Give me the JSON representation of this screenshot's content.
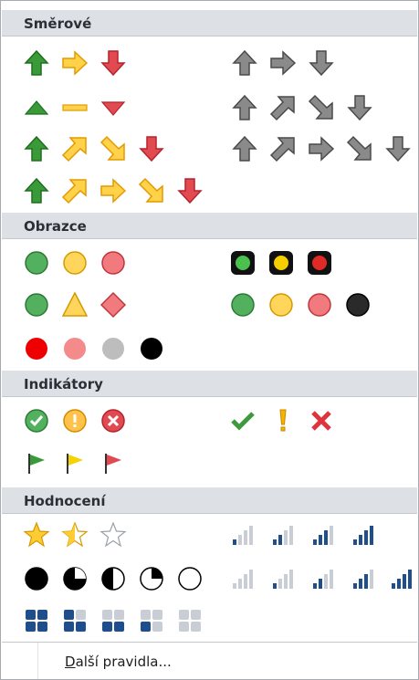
{
  "sections": {
    "directional": "Směrové",
    "shapes": "Obrazce",
    "indicators": "Indikátory",
    "ratings": "Hodnocení"
  },
  "more_rules": {
    "first": "D",
    "rest": "alší pravidla..."
  },
  "colors": {
    "green": "#3a9a3a",
    "yellow": "#f5b400",
    "red": "#e24a52",
    "gray": "#8a8a8a",
    "blue": "#1f4e8c",
    "header_bg": "#dde1e6"
  },
  "icon_sets": [
    {
      "row": "arrows-3-colored",
      "icons": [
        "arrow-up-green-icon",
        "arrow-right-yellow-icon",
        "arrow-down-red-icon"
      ]
    },
    {
      "row": "arrows-3-gray",
      "icons": [
        "arrow-up-gray-icon",
        "arrow-right-gray-icon",
        "arrow-down-gray-icon"
      ]
    },
    {
      "row": "triangles-3",
      "icons": [
        "triangle-up-green-icon",
        "dash-yellow-icon",
        "triangle-down-red-icon"
      ]
    },
    {
      "row": "arrows-4-gray",
      "icons": [
        "arrow-up-gray-icon",
        "arrow-upright-gray-icon",
        "arrow-downright-gray-icon",
        "arrow-down-gray-icon"
      ]
    },
    {
      "row": "arrows-4-colored",
      "icons": [
        "arrow-up-green-icon",
        "arrow-upright-yellow-icon",
        "arrow-downright-yellow-icon",
        "arrow-down-red-icon"
      ]
    },
    {
      "row": "arrows-5-gray",
      "icons": [
        "arrow-up-gray-icon",
        "arrow-upright-gray-icon",
        "arrow-right-gray-icon",
        "arrow-downright-gray-icon",
        "arrow-down-gray-icon"
      ]
    },
    {
      "row": "arrows-5-colored",
      "icons": [
        "arrow-up-green-icon",
        "arrow-upright-yellow-icon",
        "arrow-right-yellow-icon",
        "arrow-downright-yellow-icon",
        "arrow-down-red-icon"
      ]
    },
    {
      "row": "traffic-lights-unrimmed",
      "icons": [
        "circle-green-icon",
        "circle-yellow-icon",
        "circle-red-icon"
      ]
    },
    {
      "row": "traffic-lights-rimmed",
      "icons": [
        "light-green-icon",
        "light-yellow-icon",
        "light-red-icon"
      ]
    },
    {
      "row": "signs-3",
      "icons": [
        "circle-green-icon",
        "triangle-yellow-icon",
        "diamond-red-icon"
      ]
    },
    {
      "row": "traffic-lights-4",
      "icons": [
        "circle-green-icon",
        "circle-yellow-icon",
        "circle-red-icon",
        "circle-black-icon"
      ]
    },
    {
      "row": "red-to-black",
      "icons": [
        "circle-red-icon",
        "circle-pink-icon",
        "circle-gray-icon",
        "circle-black-icon"
      ]
    },
    {
      "row": "symbols-circled",
      "icons": [
        "check-circle-icon",
        "exclamation-circle-icon",
        "x-circle-icon"
      ]
    },
    {
      "row": "symbols-uncircled",
      "icons": [
        "check-icon",
        "exclamation-icon",
        "x-icon"
      ]
    },
    {
      "row": "flags-3",
      "icons": [
        "flag-green-icon",
        "flag-yellow-icon",
        "flag-red-icon"
      ]
    },
    {
      "row": "stars-3",
      "icons": [
        "star-full-icon",
        "star-half-icon",
        "star-empty-icon"
      ]
    },
    {
      "row": "ratings-4",
      "icons": [
        "signal-1-icon",
        "signal-2-icon",
        "signal-3-icon",
        "signal-4-icon"
      ]
    },
    {
      "row": "quarters-5",
      "icons": [
        "quarter-full-icon",
        "quarter-three-icon",
        "quarter-half-icon",
        "quarter-one-icon",
        "quarter-empty-icon"
      ]
    },
    {
      "row": "ratings-5",
      "icons": [
        "signal-0-icon",
        "signal-1-icon",
        "signal-2-icon",
        "signal-3-icon",
        "signal-4-icon"
      ]
    },
    {
      "row": "boxes-5",
      "icons": [
        "box-4-icon",
        "box-3-icon",
        "box-2-icon",
        "box-1-icon",
        "box-0-icon"
      ]
    }
  ]
}
